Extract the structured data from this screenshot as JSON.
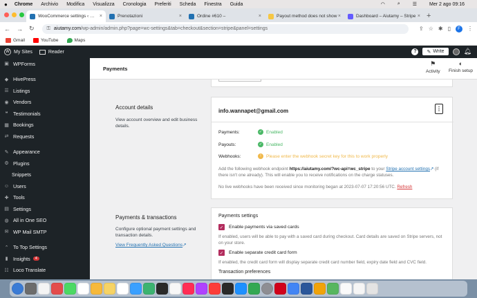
{
  "mac_menu": {
    "apple": "",
    "app": "Chrome",
    "items": [
      "Archivio",
      "Modifica",
      "Visualizza",
      "Cronologia",
      "Preferiti",
      "Scheda",
      "Finestra",
      "Guida"
    ],
    "datetime": "Mer 2 ago  09:16"
  },
  "tabs": [
    {
      "label": "WooCommerce settings ‹ — W",
      "fav_color": "#2271b1"
    },
    {
      "label": "Prenotazioni",
      "fav_color": "#2271b1"
    },
    {
      "label": "Ordine #610 –",
      "fav_color": "#2271b1"
    },
    {
      "label": "Payout method does not show",
      "fav_color": "#f6c744"
    },
    {
      "label": "Dashboard – Aiutamy – Stripe",
      "fav_color": "#635bff"
    }
  ],
  "address": {
    "host": "aiutamy.com",
    "path": "/wp-admin/admin.php?page=wc-settings&tab=checkout&section=stripe&panel=settings",
    "profile_initial": "F"
  },
  "bookmarks": [
    {
      "label": "Gmail",
      "color": "#ea4335"
    },
    {
      "label": "YouTube",
      "color": "#ff0000"
    },
    {
      "label": "Maps",
      "color": "#34a853"
    }
  ],
  "wpbar": {
    "my_sites": "My Sites",
    "reader": "Reader",
    "write": "Write"
  },
  "sidebar": [
    {
      "label": "WPForms",
      "icon": "▣",
      "sub": false
    },
    {
      "label": "HivePress",
      "icon": "◆",
      "sub": false
    },
    {
      "label": "Listings",
      "icon": "☰",
      "sub": false
    },
    {
      "label": "Vendors",
      "icon": "◉",
      "sub": false
    },
    {
      "label": "Testimonials",
      "icon": "❝",
      "sub": false
    },
    {
      "label": "Bookings",
      "icon": "▦",
      "sub": false
    },
    {
      "label": "Requests",
      "icon": "⇄",
      "sub": false
    },
    {
      "label": "Appearance",
      "icon": "✎",
      "sub": false
    },
    {
      "label": "Plugins",
      "icon": "⚙",
      "sub": false
    },
    {
      "label": "Snippets",
      "icon": "",
      "sub": true
    },
    {
      "label": "Users",
      "icon": "☺",
      "sub": false
    },
    {
      "label": "Tools",
      "icon": "✚",
      "sub": false
    },
    {
      "label": "Settings",
      "icon": "▤",
      "sub": false
    },
    {
      "label": "All in One SEO",
      "icon": "◍",
      "sub": false
    },
    {
      "label": "WP Mail SMTP",
      "icon": "✉",
      "sub": false
    },
    {
      "label": "To Top Settings",
      "icon": "⌃",
      "sub": false
    },
    {
      "label": "Insights",
      "icon": "▮",
      "sub": false,
      "badge": "4"
    },
    {
      "label": "Loco Translate",
      "icon": "☷",
      "sub": false
    }
  ],
  "header": {
    "title": "Payments",
    "activity": "Activity",
    "finish_setup": "Finish setup"
  },
  "account": {
    "title": "Account details",
    "desc": "View account overview and edit business details.",
    "email": "info.wannapet@gmail.com",
    "payments_label": "Payments:",
    "payments_value": "Enabled",
    "payouts_label": "Payouts:",
    "payouts_value": "Enabled",
    "webhooks_label": "Webhooks:",
    "webhooks_value": "Please enter the webhook secret key for this to work properly",
    "webhook_info_1": "Add the following webhook endpoint",
    "webhook_endpoint": "https://aiutamy.com/?wc-api=wc_stripe",
    "webhook_info_2": "to your",
    "stripe_link": "Stripe account settings",
    "webhook_info_3": "(if there isn't one already). This will enable you to receive notifications on the charge statuses.",
    "no_live": "No live webhooks have been received since monitoring began at 2023-07-07 17:20:56 UTC.",
    "refresh": "Refresh"
  },
  "payments_tx": {
    "title": "Payments & transactions",
    "desc": "Configure optional payment settings and transaction details.",
    "faq": "View Frequently Asked Questions",
    "settings_title": "Payments settings",
    "saved_cards_label": "Enable payments via saved cards",
    "saved_cards_help": "If enabled, users will be able to pay with a saved card during checkout. Card details are saved on Stripe servers, not on your store.",
    "separate_label": "Enable separate credit card form",
    "separate_help": "If enabled, the credit card form will display separate credit card number field, expiry date field and CVC field.",
    "tx_prefs": "Transaction preferences"
  },
  "dock_colors": [
    "#3a7bd5",
    "#6c6c6c",
    "#f4f4f4",
    "#e34c4c",
    "#4cd964",
    "#ffffff",
    "#f6b93b",
    "#f6d365",
    "#ffffff",
    "#3aa0ff",
    "#3cb371",
    "#2a2a2a",
    "#f7f7f7",
    "#ff2d55",
    "#b042ff",
    "#fc3d39",
    "#2a2a2a",
    "#1e90ff",
    "#34a853",
    "#8e8e93",
    "#d0021b",
    "#4285f4",
    "#2b579a",
    "#f0a30a",
    "#57b65f",
    "#fafafa",
    "#f5f5f5",
    "#e3e3e3"
  ]
}
